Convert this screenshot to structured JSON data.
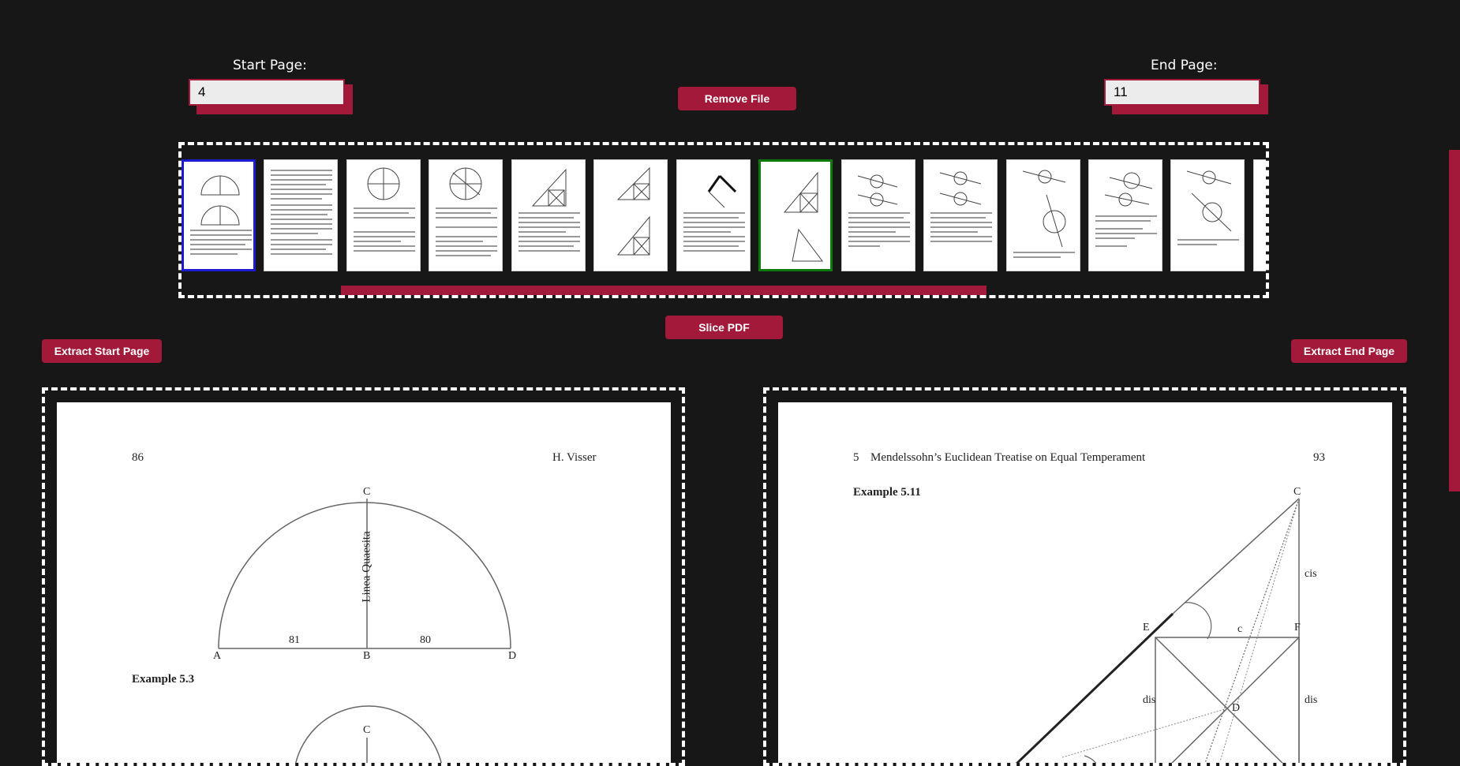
{
  "start": {
    "label": "Start Page:",
    "value": "4"
  },
  "end": {
    "label": "End Page:",
    "value": "11"
  },
  "buttons": {
    "remove": "Remove File",
    "slice": "Slice PDF",
    "extract_start": "Extract Start Page",
    "extract_end": "Extract End Page"
  },
  "thumbnails": {
    "count": 13,
    "start_index": 0,
    "end_index": 7
  },
  "left_page": {
    "page_number": "86",
    "author": "H. Visser",
    "points": {
      "c": "C",
      "a": "A",
      "b": "B",
      "d": "D",
      "c2": "C"
    },
    "vertical_label": "Linea Quaesita",
    "left_value": "81",
    "right_value": "80",
    "caption": "Example 5.3"
  },
  "right_page": {
    "chapter": "5",
    "title": "Mendelssohn’s Euclidean Treatise on Equal Temperament",
    "page_number": "93",
    "caption": "Example 5.11",
    "points": {
      "c": "C",
      "e": "E",
      "f": "F",
      "d": "D"
    },
    "labels": {
      "cis": "cis",
      "c": "c",
      "dis_left": "dis",
      "dis_right": "dis"
    }
  },
  "colors": {
    "accent": "#a3193a",
    "background": "#171717",
    "start_border": "#1b1bd0",
    "end_border": "#0b7a0b"
  }
}
